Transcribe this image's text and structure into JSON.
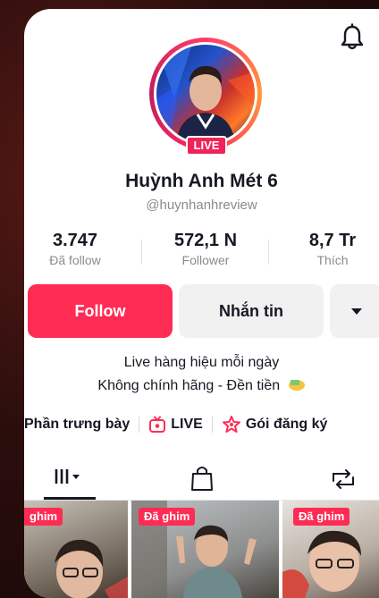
{
  "profile": {
    "live_badge": "LIVE",
    "name": "Huỳnh Anh Mét 6",
    "handle": "@huynhanhreview"
  },
  "stats": [
    {
      "value": "3.747",
      "label": "Đã follow"
    },
    {
      "value": "572,1 N",
      "label": "Follower"
    },
    {
      "value": "8,7 Tr",
      "label": "Thích"
    }
  ],
  "actions": {
    "follow": "Follow",
    "message": "Nhắn tin"
  },
  "bio": {
    "line1": "Live hàng hiệu mỗi ngày",
    "line2": "Không chính hãng - Đền tiền"
  },
  "links": {
    "showcase": "Phần trưng bày",
    "live": "LIVE",
    "subscription": "Gói đăng ký"
  },
  "tabs": [
    {
      "icon": "grid-icon"
    },
    {
      "icon": "shopping-bag-icon"
    },
    {
      "icon": "repost-icon"
    }
  ],
  "videos": [
    {
      "pinned_label": "ghim"
    },
    {
      "pinned_label": "Đã ghim"
    },
    {
      "pinned_label": "Đã ghim"
    }
  ],
  "colors": {
    "accent": "#fe2c55",
    "text": "#161823",
    "muted": "#8a8b91",
    "button_gray": "#f1f1f2"
  }
}
